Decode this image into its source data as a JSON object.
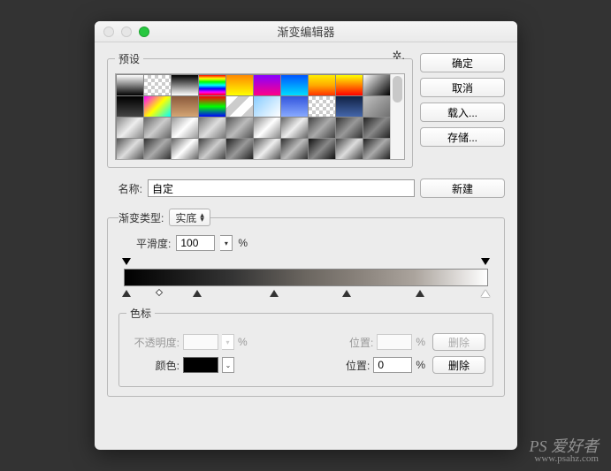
{
  "title": "渐变编辑器",
  "presets_label": "预设",
  "buttons": {
    "ok": "确定",
    "cancel": "取消",
    "load": "载入...",
    "save": "存储...",
    "new": "新建",
    "delete": "删除"
  },
  "name_label": "名称:",
  "name_value": "自定",
  "type_label": "渐变类型:",
  "type_value": "实底",
  "smooth_label": "平滑度:",
  "smooth_value": "100",
  "percent": "%",
  "stops_label": "色标",
  "opacity_label": "不透明度:",
  "position_label": "位置:",
  "position_value": "0",
  "color_label": "颜色:",
  "opacity_value": "",
  "opacity_pos": "",
  "watermark": {
    "brand": "PS 爱好者",
    "url": "www.psahz.com"
  },
  "swatches": [
    "linear-gradient(#fff,#000)",
    "#f0f0f0",
    "linear-gradient(#000,#fff)",
    "linear-gradient(#ff0000,#ffff00,#00ff00,#00ffff,#0000ff,#ff00ff,#ff0000)",
    "linear-gradient(#ff8800,#ffff00)",
    "linear-gradient(#8800ff,#ff0088)",
    "linear-gradient(#0055ff,#00ddff)",
    "linear-gradient(#ffee00,#ffaa00,#ff3300)",
    "linear-gradient(#ffff00,#ff0000)",
    "linear-gradient(135deg,#fff,#000)",
    "linear-gradient(#000,#444)",
    "linear-gradient(135deg,#ff00ff,#ffff00,#00ffff)",
    "linear-gradient(#8b5a3c,#d4a574)",
    "linear-gradient(#ff0000,#00ff00,#0000ff)",
    "linear-gradient(135deg,#fff 25%,#ccc 25%,#ccc 50%,#fff 50%,#fff 75%,#ccc 75%)",
    "linear-gradient(135deg,#88ccff,#fff)",
    "linear-gradient(#3355dd,#88aaff)",
    "#f0f0f0",
    "linear-gradient(#112244,#4466aa)",
    "linear-gradient(135deg,#c0c0c0,#707070)",
    "linear-gradient(135deg,#888,#eee,#888)",
    "linear-gradient(135deg,#666,#ccc,#666)",
    "linear-gradient(135deg,#999,#fff,#999)",
    "linear-gradient(135deg,#777,#ddd,#777)",
    "linear-gradient(135deg,#555,#bbb,#555)",
    "linear-gradient(135deg,#888,#fff,#888)",
    "linear-gradient(135deg,#666,#eee,#666)",
    "linear-gradient(135deg,#444,#aaa,#444)",
    "linear-gradient(135deg,#333,#999,#333)",
    "linear-gradient(135deg,#222,#888,#222)",
    "linear-gradient(135deg,#555,#ddd,#555)",
    "linear-gradient(135deg,#333,#aaa,#333)",
    "linear-gradient(135deg,#666,#fff,#666)",
    "linear-gradient(135deg,#444,#ccc,#444)",
    "linear-gradient(135deg,#222,#999,#222)",
    "linear-gradient(135deg,#555,#eee,#555)",
    "linear-gradient(135deg,#333,#bbb,#333)",
    "linear-gradient(135deg,#111,#888,#111)",
    "linear-gradient(135deg,#444,#ddd,#444)",
    "linear-gradient(135deg,#222,#aaa,#222)"
  ]
}
